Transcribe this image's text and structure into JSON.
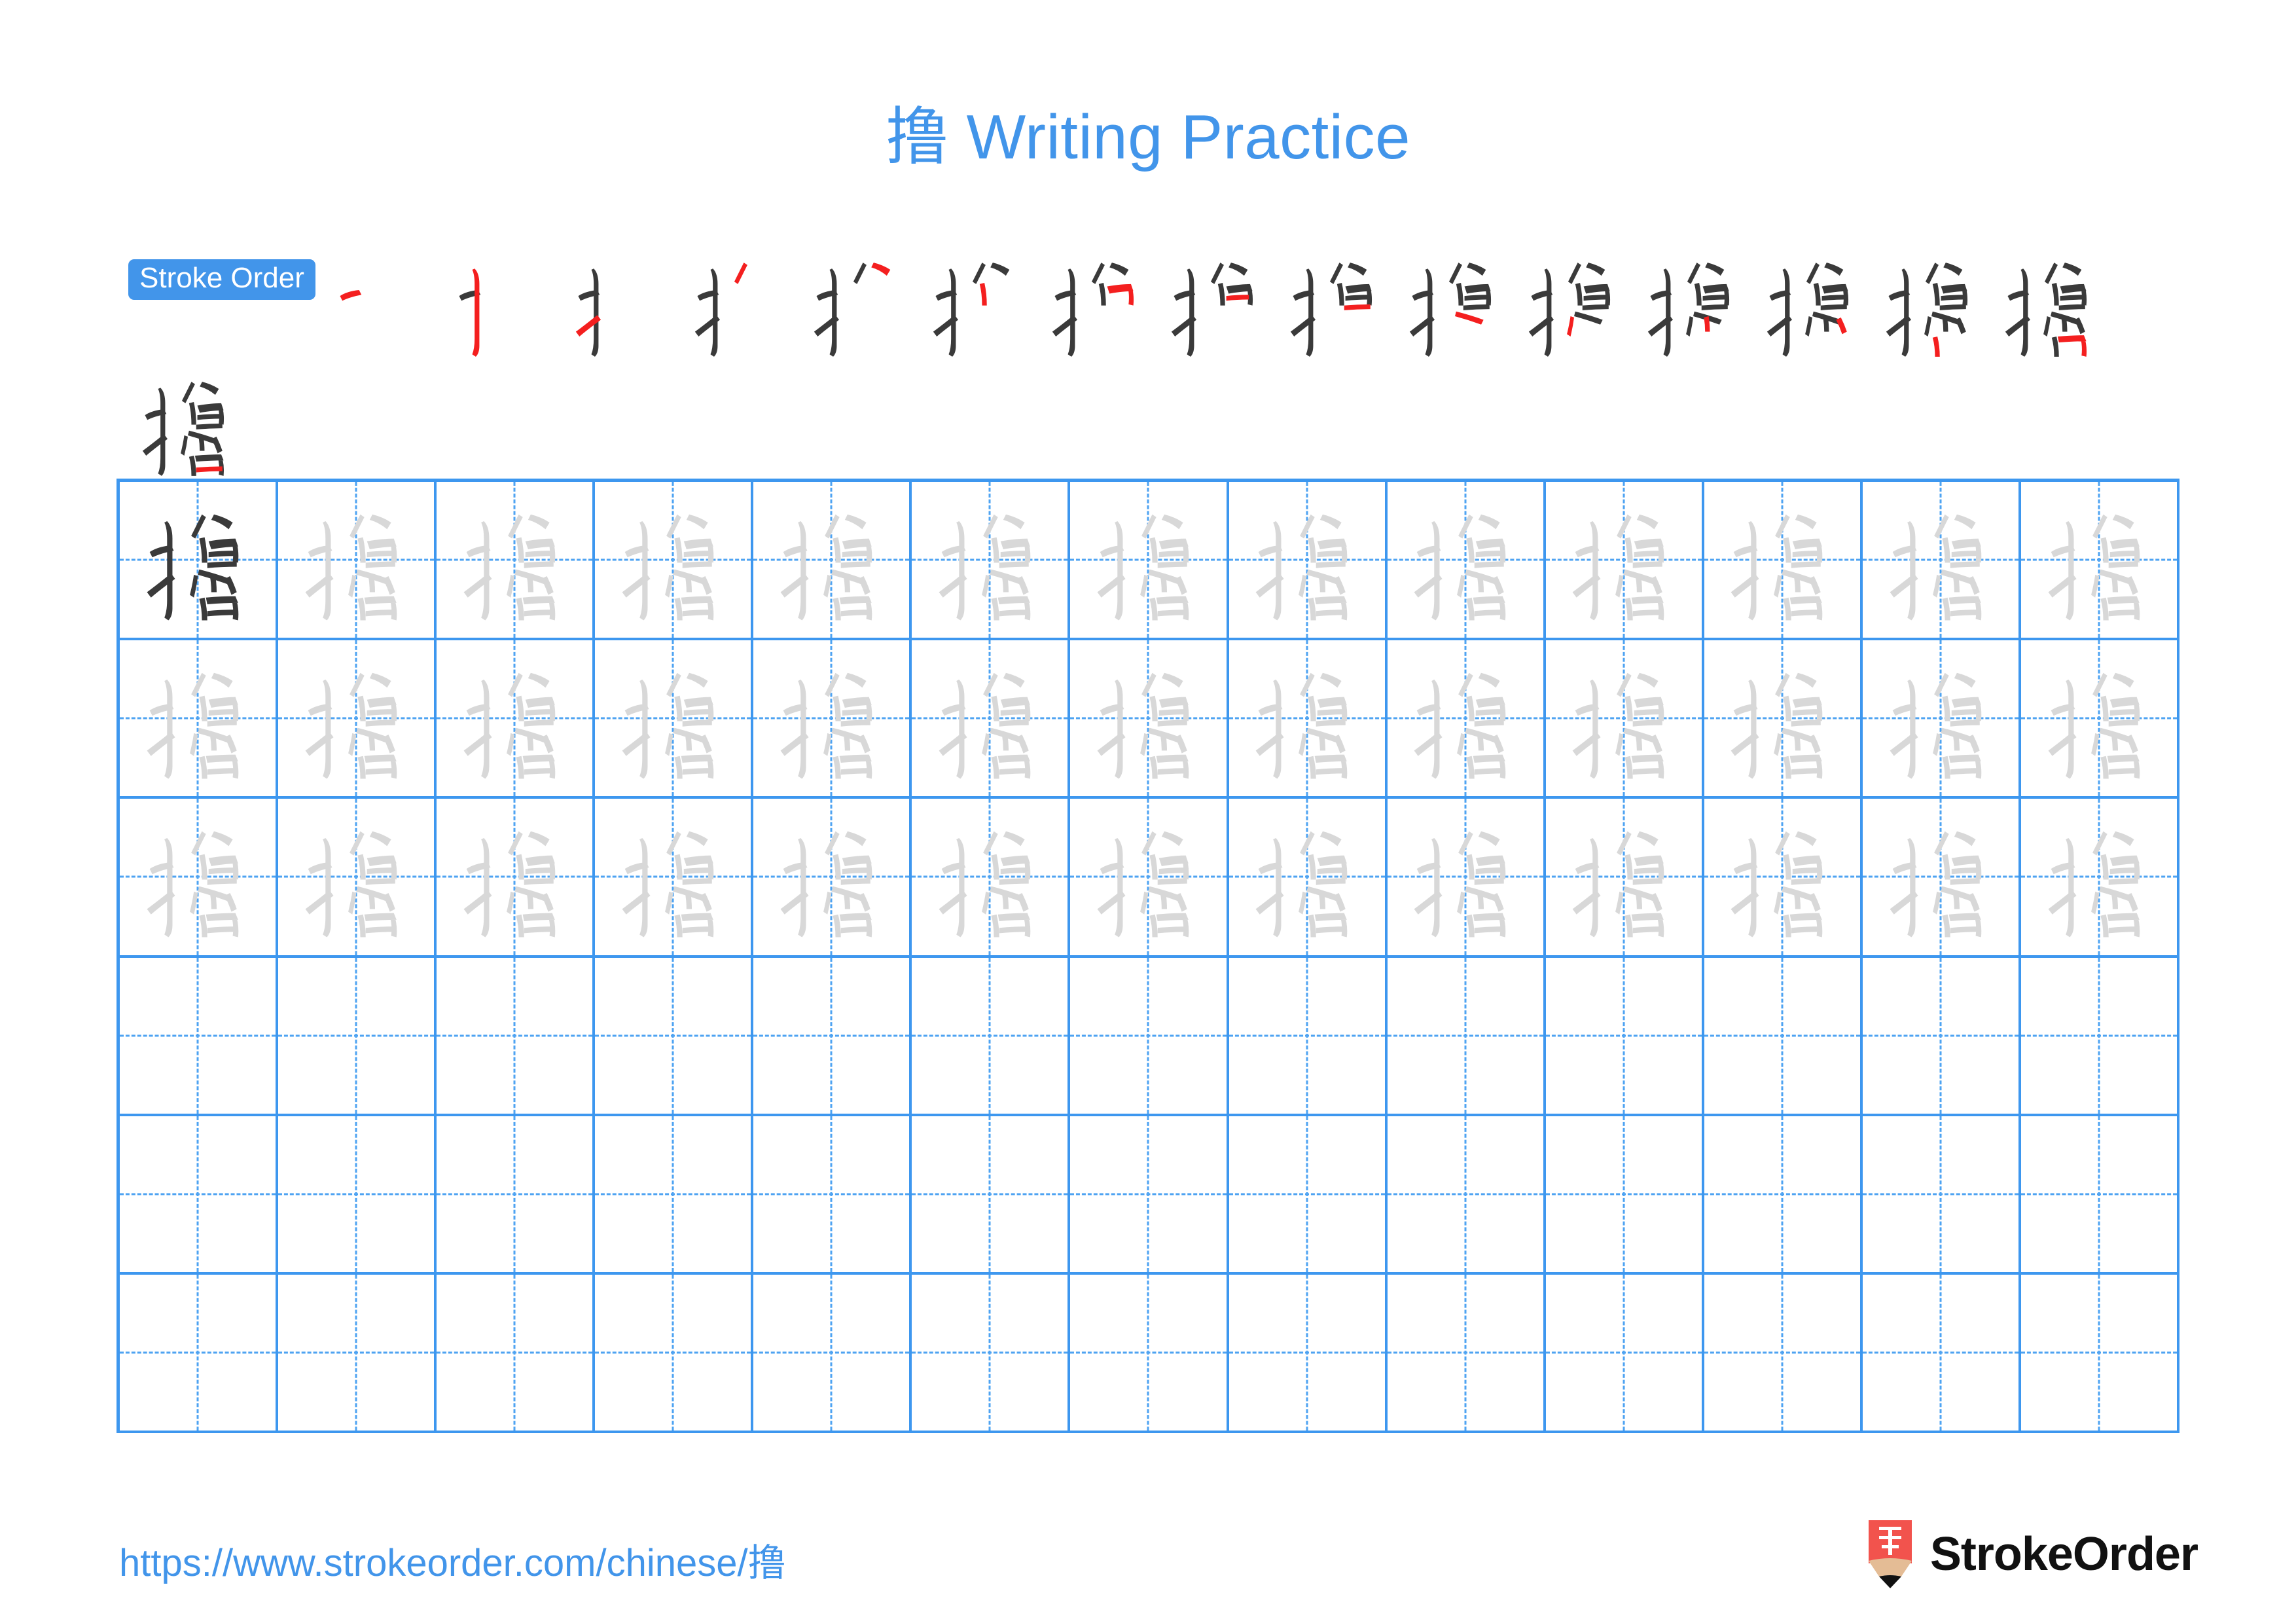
{
  "document": {
    "character": "撸",
    "title": "撸 Writing Practice",
    "type": "chinese-character-writing-practice-worksheet"
  },
  "stroke_order": {
    "label": "Stroke Order",
    "total_strokes": 16,
    "steps": [
      {
        "index": 1,
        "strokes_shown": 1,
        "new_stroke_color": "#f41f1f"
      },
      {
        "index": 2,
        "strokes_shown": 2,
        "new_stroke_color": "#f41f1f"
      },
      {
        "index": 3,
        "strokes_shown": 3,
        "new_stroke_color": "#f41f1f"
      },
      {
        "index": 4,
        "strokes_shown": 4,
        "new_stroke_color": "#f41f1f"
      },
      {
        "index": 5,
        "strokes_shown": 5,
        "new_stroke_color": "#f41f1f"
      },
      {
        "index": 6,
        "strokes_shown": 6,
        "new_stroke_color": "#f41f1f"
      },
      {
        "index": 7,
        "strokes_shown": 7,
        "new_stroke_color": "#f41f1f"
      },
      {
        "index": 8,
        "strokes_shown": 8,
        "new_stroke_color": "#f41f1f"
      },
      {
        "index": 9,
        "strokes_shown": 9,
        "new_stroke_color": "#f41f1f"
      },
      {
        "index": 10,
        "strokes_shown": 10,
        "new_stroke_color": "#f41f1f"
      },
      {
        "index": 11,
        "strokes_shown": 11,
        "new_stroke_color": "#f41f1f"
      },
      {
        "index": 12,
        "strokes_shown": 12,
        "new_stroke_color": "#f41f1f"
      },
      {
        "index": 13,
        "strokes_shown": 13,
        "new_stroke_color": "#f41f1f"
      },
      {
        "index": 14,
        "strokes_shown": 14,
        "new_stroke_color": "#f41f1f"
      },
      {
        "index": 15,
        "strokes_shown": 15,
        "new_stroke_color": "#f41f1f"
      },
      {
        "index": 16,
        "strokes_shown": 16,
        "new_stroke_color": "#f41f1f"
      }
    ]
  },
  "practice_grid": {
    "columns": 13,
    "rows": 6,
    "cells": [
      [
        "dark",
        "light",
        "light",
        "light",
        "light",
        "light",
        "light",
        "light",
        "light",
        "light",
        "light",
        "light",
        "light"
      ],
      [
        "light",
        "light",
        "light",
        "light",
        "light",
        "light",
        "light",
        "light",
        "light",
        "light",
        "light",
        "light",
        "light"
      ],
      [
        "light",
        "light",
        "light",
        "light",
        "light",
        "light",
        "light",
        "light",
        "light",
        "light",
        "light",
        "light",
        "light"
      ],
      [
        "empty",
        "empty",
        "empty",
        "empty",
        "empty",
        "empty",
        "empty",
        "empty",
        "empty",
        "empty",
        "empty",
        "empty",
        "empty"
      ],
      [
        "empty",
        "empty",
        "empty",
        "empty",
        "empty",
        "empty",
        "empty",
        "empty",
        "empty",
        "empty",
        "empty",
        "empty",
        "empty"
      ],
      [
        "empty",
        "empty",
        "empty",
        "empty",
        "empty",
        "empty",
        "empty",
        "empty",
        "empty",
        "empty",
        "empty",
        "empty",
        "empty"
      ]
    ],
    "guide_style": "dashed-cross",
    "border_color": "#3d97ef",
    "guide_color": "#4ea3f2",
    "dark_ink_color": "#3a3a3a",
    "light_ink_color": "#d8d8d8"
  },
  "footer": {
    "url": "https://www.strokeorder.com/chinese/撸",
    "brand_name": "StrokeOrder",
    "logo_character": "字",
    "logo_body_color": "#f2534d",
    "logo_wood_color": "#e4bc95",
    "logo_tip_color": "#111111"
  },
  "colors": {
    "accent_blue": "#4295ea",
    "grid_blue": "#3d97ef",
    "stroke_red": "#f41f1f",
    "background": "#ffffff"
  }
}
